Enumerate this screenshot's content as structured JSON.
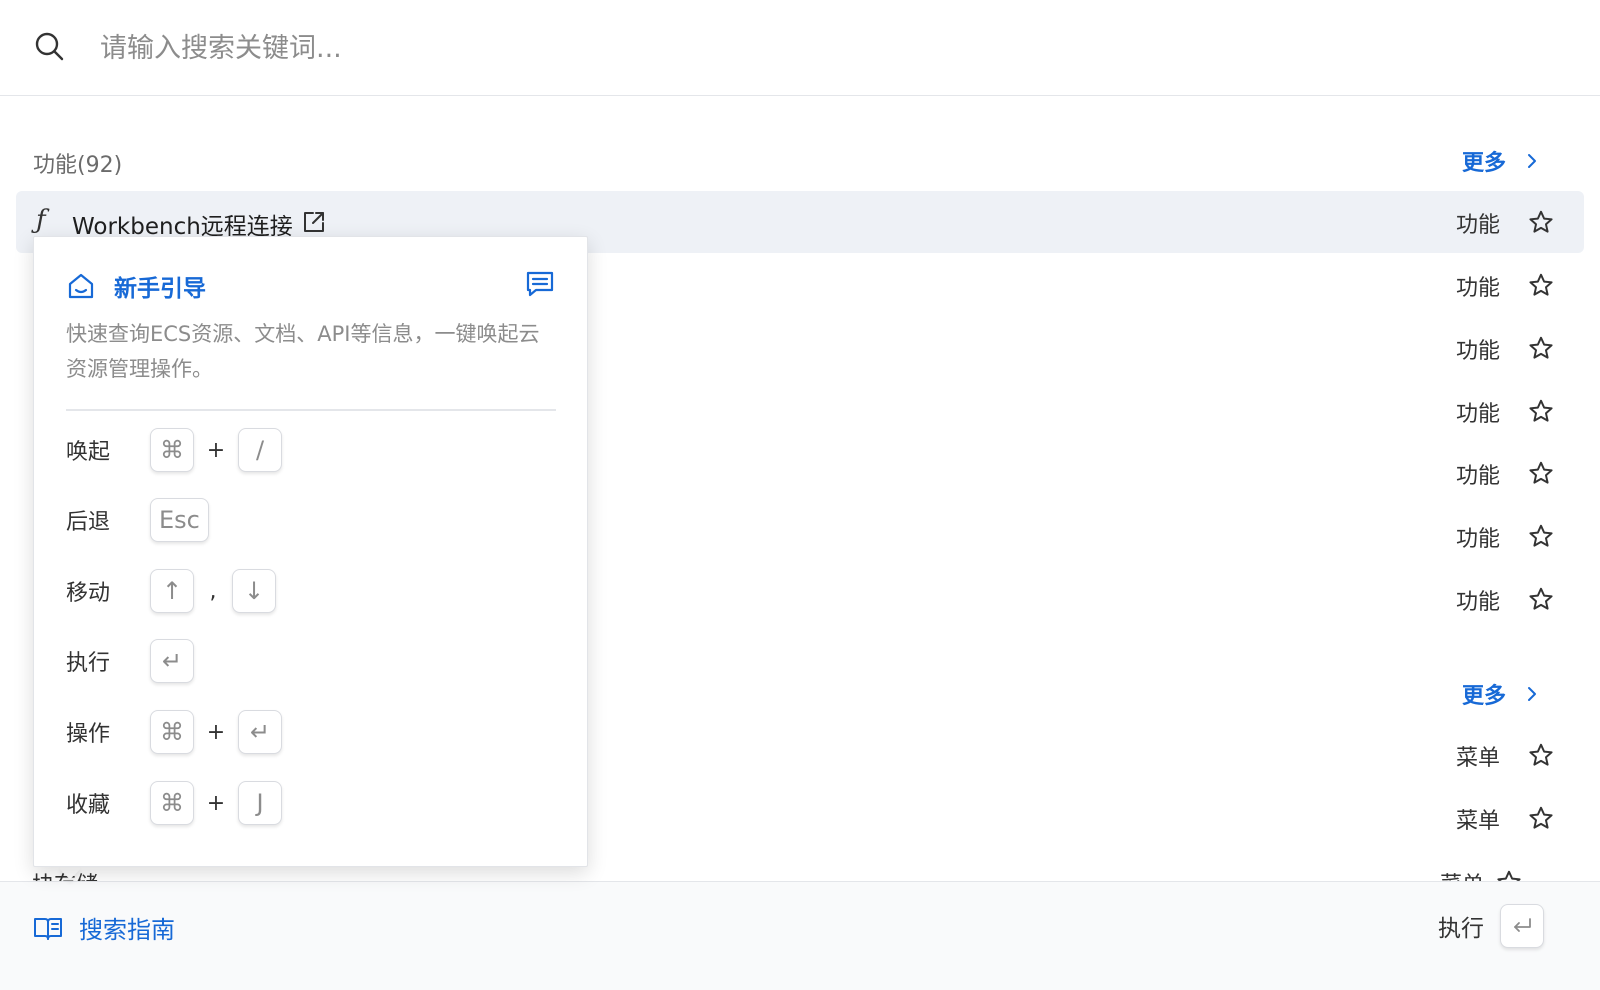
{
  "search": {
    "placeholder": "请输入搜索关键词..."
  },
  "groups": [
    {
      "title": "功能(92)",
      "more_label": "更多",
      "items": [
        {
          "label": "Workbench远程连接",
          "type": "功能",
          "active": true
        },
        {
          "label": "",
          "type": "功能"
        },
        {
          "label": "",
          "type": "功能"
        },
        {
          "label": "",
          "type": "功能"
        },
        {
          "label": "",
          "type": "功能"
        },
        {
          "label": "",
          "type": "功能"
        },
        {
          "label": "",
          "type": "功能"
        }
      ]
    },
    {
      "title": "",
      "more_label": "更多",
      "items": [
        {
          "label": "",
          "type": "菜单"
        },
        {
          "label": "",
          "type": "菜单"
        }
      ],
      "partial_item": {
        "label": "块存储",
        "type": "菜单"
      }
    }
  ],
  "popover": {
    "title": "新手引导",
    "description": "快速查询ECS资源、文档、API等信息，一键唤起云资源管理操作。",
    "shortcuts": [
      {
        "label": "唤起",
        "keys": [
          "⌘",
          "/"
        ],
        "separator": "+"
      },
      {
        "label": "后退",
        "keys": [
          "Esc"
        ]
      },
      {
        "label": "移动",
        "keys": [
          "↑",
          "↓"
        ],
        "separator": ","
      },
      {
        "label": "执行",
        "keys": [
          "↵"
        ]
      },
      {
        "label": "操作",
        "keys": [
          "⌘",
          "↵"
        ],
        "separator": "+"
      },
      {
        "label": "收藏",
        "keys": [
          "⌘",
          "J"
        ],
        "separator": "+"
      }
    ]
  },
  "footer": {
    "guide_label": "搜索指南",
    "execute_label": "执行"
  },
  "icons": {
    "search": "search-icon",
    "function": "function-icon",
    "external": "external-link-icon",
    "star": "star-outline-icon",
    "chevron": "chevron-right-icon",
    "home": "home-icon",
    "message": "message-icon",
    "book": "book-icon",
    "enter": "enter-key-icon"
  },
  "colors": {
    "accent": "#1769d6",
    "active_row": "#eef1f6",
    "muted_text": "#8c8c8c"
  }
}
